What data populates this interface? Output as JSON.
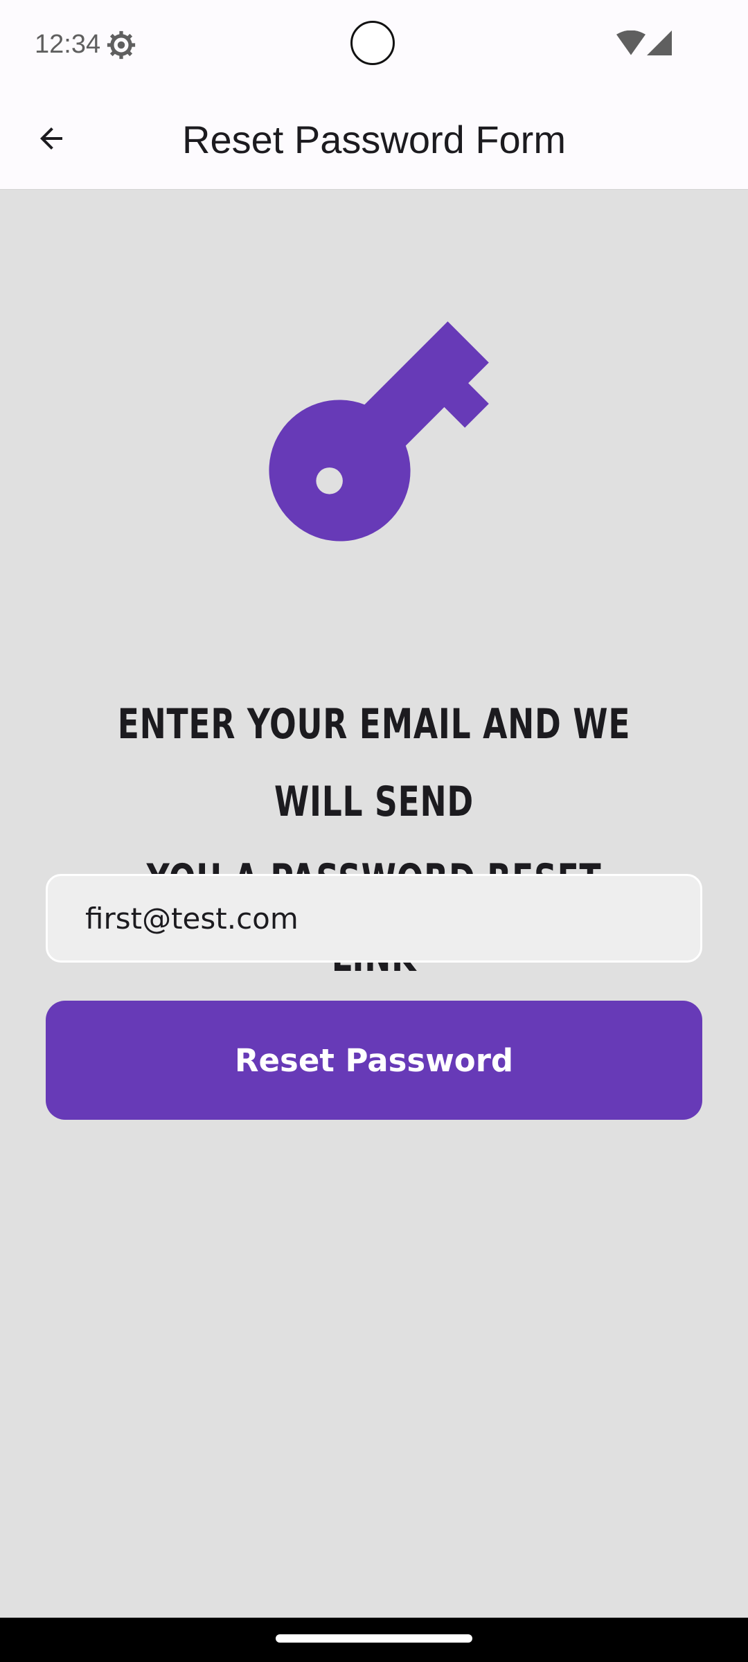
{
  "status_bar": {
    "time": "12:34",
    "icons": [
      "settings-gear-icon",
      "wifi-icon",
      "cellular-signal-icon"
    ]
  },
  "app_bar": {
    "title": "Reset Password Form",
    "back_icon": "arrow-back-icon"
  },
  "hero": {
    "icon": "key-icon",
    "icon_color": "#673ab7"
  },
  "headline": {
    "line1": "ENTER YOUR EMAIL AND WE WILL SEND",
    "line2": "YOU A PASSWORD RESET LINK"
  },
  "form": {
    "email_value": "first@test.com",
    "submit_label": "Reset Password"
  },
  "colors": {
    "accent": "#673ab7",
    "background": "#e0e0e0",
    "surface": "#fdfbfe"
  }
}
